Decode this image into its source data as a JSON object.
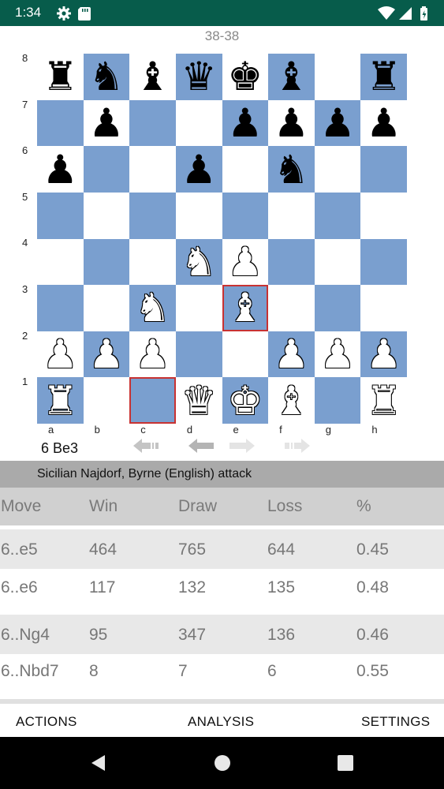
{
  "status_bar": {
    "time": "1:34",
    "left_icons": [
      "gear-icon",
      "sd-card-icon"
    ],
    "right_icons": [
      "wifi-icon",
      "cell-signal-icon",
      "battery-icon"
    ],
    "background": "#075c4b"
  },
  "board": {
    "score": "38-38",
    "ranks": [
      "8",
      "7",
      "6",
      "5",
      "4",
      "3",
      "2",
      "1"
    ],
    "files": [
      "a",
      "b",
      "c",
      "d",
      "e",
      "f",
      "g",
      "h"
    ],
    "light_color": "#ffffff",
    "dark_color": "#7a9fcf",
    "highlight_color": "#c83232",
    "highlighted_squares": [
      "e3",
      "c1"
    ],
    "position": {
      "a8": "r",
      "b8": "n",
      "c8": "b",
      "d8": "q",
      "e8": "k",
      "f8": "b",
      "h8": "r",
      "b7": "p",
      "e7": "p",
      "f7": "p",
      "g7": "p",
      "h7": "p",
      "a6": "p",
      "d6": "p",
      "f6": "n",
      "d4": "N",
      "e4": "P",
      "c3": "N",
      "e3": "B",
      "a2": "P",
      "b2": "P",
      "c2": "P",
      "f2": "P",
      "g2": "P",
      "h2": "P",
      "a1": "R",
      "d1": "Q",
      "e1": "K",
      "f1": "B",
      "h1": "R"
    },
    "last_move": "6 Be3"
  },
  "navigation": {
    "buttons": [
      "first-move-icon",
      "previous-move-icon",
      "next-move-icon",
      "last-move-icon"
    ]
  },
  "opening": {
    "name": "Sicilian Najdorf, Byrne (English) attack"
  },
  "stats_table": {
    "headers": [
      "Move",
      "Win",
      "Draw",
      "Loss",
      "%"
    ],
    "rows": [
      [
        "6..e5",
        "464",
        "765",
        "644",
        "0.45"
      ],
      [
        "6..e6",
        "117",
        "132",
        "135",
        "0.48"
      ],
      [
        "6..Ng4",
        "95",
        "347",
        "136",
        "0.46"
      ],
      [
        "6..Nbd7",
        "8",
        "7",
        "6",
        "0.55"
      ]
    ]
  },
  "action_bar": {
    "actions": "ACTIONS",
    "analysis": "ANALYSIS",
    "settings": "SETTINGS"
  },
  "system_nav": {
    "buttons": [
      "back-icon",
      "home-icon",
      "recents-icon"
    ]
  }
}
